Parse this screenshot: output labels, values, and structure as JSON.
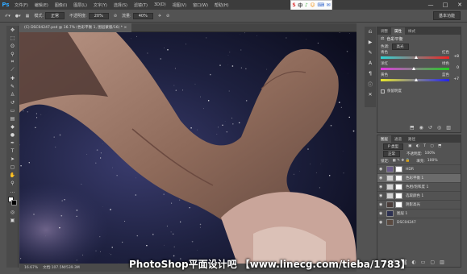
{
  "app": {
    "logo": "Ps"
  },
  "menu": [
    "文件(F)",
    "编辑(E)",
    "图像(I)",
    "图层(L)",
    "文字(Y)",
    "选择(S)",
    "滤镜(T)",
    "3D(D)",
    "视图(V)",
    "窗口(W)",
    "帮助(H)"
  ],
  "tray": {
    "items": [
      "S",
      "中",
      "♪",
      "☺",
      "⌨",
      "✉"
    ]
  },
  "window_controls": [
    "—",
    "□",
    "✕"
  ],
  "options": {
    "mode_label": "模式:",
    "mode_value": "正常",
    "opacity_label": "不透明度:",
    "opacity_value": "20%",
    "flow_label": "流量:",
    "flow_value": "40%",
    "workspace": "基本功能"
  },
  "document": {
    "tab_title": "(C) DSC04247.psd @ 16.7% (色彩平衡 1, 图层蒙版/16) * ×",
    "zoom": "16.67%",
    "doc_size": "文档:107.5M/539.3M"
  },
  "properties": {
    "tabs": [
      "调整",
      "属性",
      "样式"
    ],
    "active_tab": "属性",
    "title": "色彩平衡",
    "tone_label": "色调:",
    "tone_value": "高光",
    "sliders": [
      {
        "left": "青色",
        "right": "红色",
        "value": "+8",
        "pos": 0.54,
        "colors": [
          "#2fd4d4",
          "#e22"
        ]
      },
      {
        "left": "洋红",
        "right": "绿色",
        "value": "0",
        "pos": 0.5,
        "colors": [
          "#e03ae0",
          "#2c2"
        ]
      },
      {
        "left": "黄色",
        "right": "蓝色",
        "value": "+7",
        "pos": 0.54,
        "colors": [
          "#e8e82a",
          "#22e"
        ]
      }
    ],
    "preserve_label": "保留明度"
  },
  "layers": {
    "tabs": [
      "图层",
      "通道",
      "路径"
    ],
    "active_tab": "图层",
    "kind_value": "P 类型",
    "blend_value": "正常",
    "opacity_label": "不透明度:",
    "opacity_value": "100%",
    "lock_label": "锁定:",
    "fill_label": "填充:",
    "fill_value": "100%",
    "items": [
      {
        "name": "HDR",
        "thumb": "#6b5c8a",
        "mask": true,
        "selected": false
      },
      {
        "name": "色彩平衡 1",
        "thumb": "#d0d0d0",
        "mask": true,
        "selected": true
      },
      {
        "name": "色相/饱和度 1",
        "thumb": "#d0d0d0",
        "mask": true,
        "selected": false
      },
      {
        "name": "选取颜色 1",
        "thumb": "#d0d0d0",
        "mask": true,
        "selected": false
      },
      {
        "name": "阴影高光",
        "thumb": "#4a3d3a",
        "mask": true,
        "selected": false
      },
      {
        "name": "图层 1",
        "thumb": "#2d3152",
        "mask": false,
        "selected": false
      },
      {
        "name": "DSC04247",
        "thumb": "#5a4a40",
        "mask": false,
        "selected": false
      }
    ]
  },
  "watermark": "PhotoShop平面设计吧 【www.linecg.com/tieba/1783】"
}
